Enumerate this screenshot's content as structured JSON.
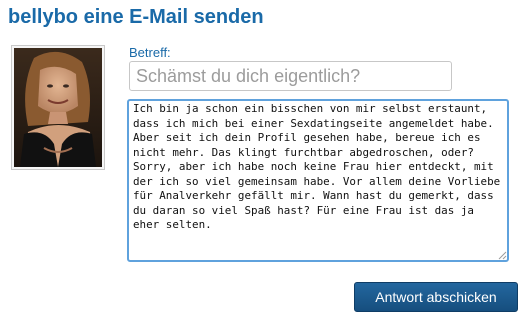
{
  "header": {
    "title": "bellybo eine E-Mail senden"
  },
  "profile": {
    "photo": "profile-photo"
  },
  "form": {
    "subject_label": "Betreff:",
    "subject_value": "",
    "subject_placeholder": "Schämst du dich eigentlich?",
    "message_value": "Ich bin ja schon ein bisschen von mir selbst erstaunt, dass ich mich bei einer Sexdatingseite angemeldet habe. Aber seit ich dein Profil gesehen habe, bereue ich es nicht mehr. Das klingt furchtbar abgedroschen, oder? Sorry, aber ich habe noch keine Frau hier entdeckt, mit der ich so viel gemeinsam habe. Vor allem deine Vorliebe für Analverkehr gefällt mir. Wann hast du gemerkt, dass du daran so viel Spaß hast? Für eine Frau ist das ja eher selten.",
    "submit_label": "Antwort abschicken"
  },
  "colors": {
    "title": "#1a6aa8",
    "label": "#1a6aa8",
    "focus_border": "#5fa2dd",
    "button_bg": "#1c5d93",
    "button_text": "#ffffff"
  }
}
